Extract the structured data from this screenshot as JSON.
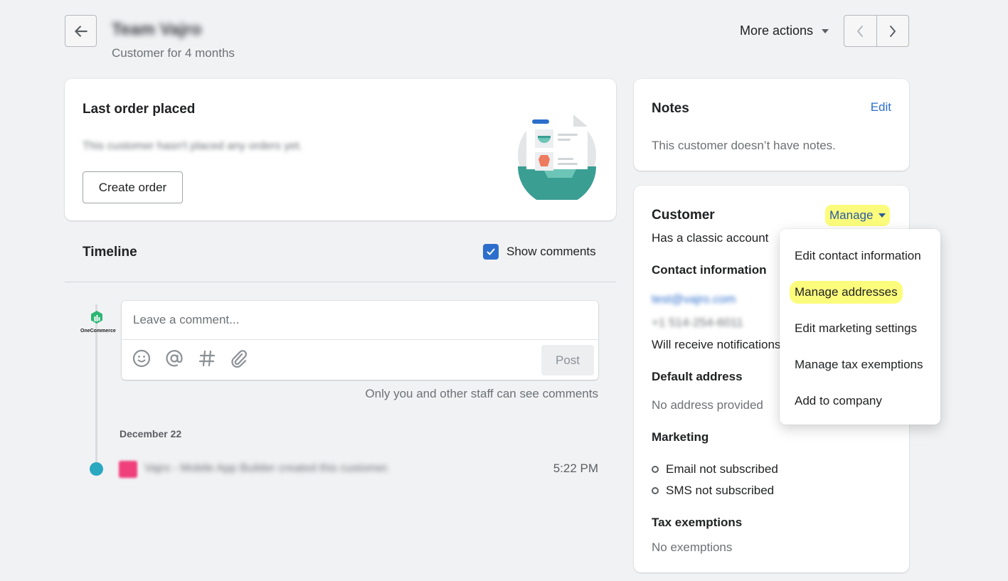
{
  "header": {
    "title": "Team Vajro",
    "subtitle": "Customer for 4 months",
    "more_actions_label": "More actions"
  },
  "last_order": {
    "title": "Last order placed",
    "message": "This customer hasn't placed any orders yet.",
    "create_order_label": "Create order"
  },
  "timeline": {
    "title": "Timeline",
    "show_comments_label": "Show comments",
    "show_comments_checked": true,
    "avatar_label": "OneCommerce",
    "comment_placeholder": "Leave a comment...",
    "post_label": "Post",
    "hint": "Only you and other staff can see comments",
    "groups": [
      {
        "date": "December 22",
        "events": [
          {
            "text": "Vajro - Mobile App Builder created this customer.",
            "time": "5:22 PM"
          }
        ]
      }
    ]
  },
  "notes": {
    "title": "Notes",
    "edit_label": "Edit",
    "text": "This customer doesn’t have notes."
  },
  "customer": {
    "title": "Customer",
    "manage_label": "Manage",
    "account_status": "Has a classic account",
    "contact_heading": "Contact information",
    "email": "test@vajro.com",
    "phone": "+1 514-254-6011",
    "notifications": "Will receive notifications in English",
    "default_address_heading": "Default address",
    "default_address": "No address provided",
    "marketing_heading": "Marketing",
    "marketing": [
      "Email not subscribed",
      "SMS not subscribed"
    ],
    "tax_heading": "Tax exemptions",
    "tax_value": "No exemptions"
  },
  "manage_menu": {
    "items": [
      {
        "label": "Edit contact information",
        "highlighted": false
      },
      {
        "label": "Manage addresses",
        "highlighted": true
      },
      {
        "label": "Edit marketing settings",
        "highlighted": false
      },
      {
        "label": "Manage tax exemptions",
        "highlighted": false
      },
      {
        "label": "Add to company",
        "highlighted": false
      }
    ]
  },
  "colors": {
    "accent": "#2c6ecb",
    "highlight": "#fcfc7c",
    "timeline_dot": "#29a8c0",
    "illustration_teal": "#3a9e93"
  }
}
